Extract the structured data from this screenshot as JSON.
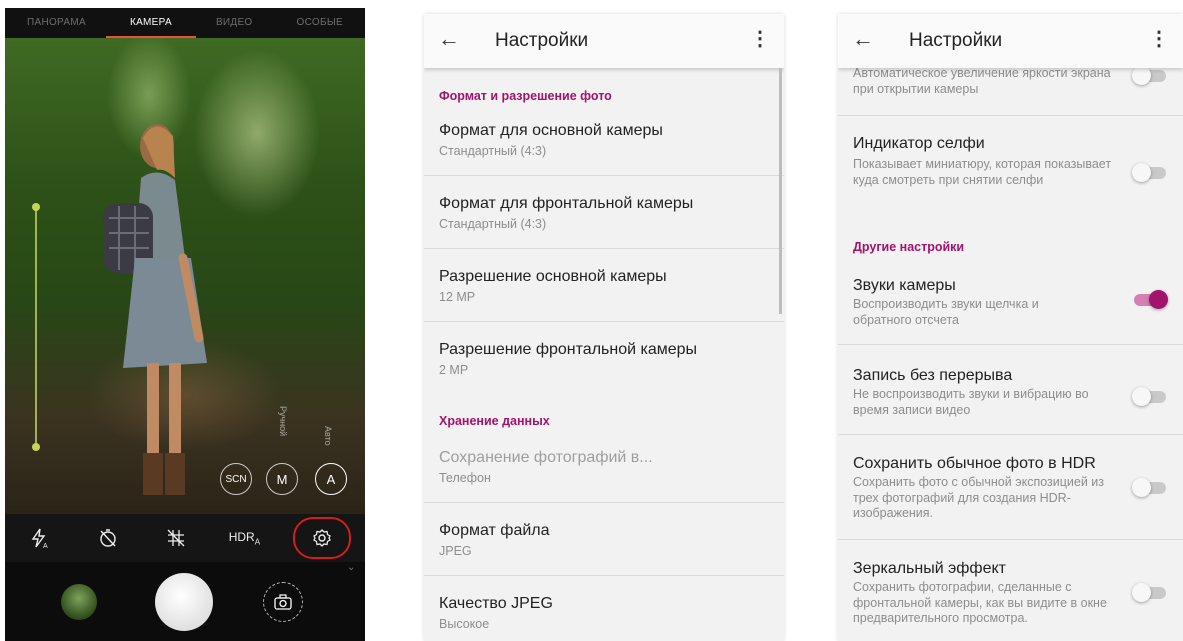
{
  "camera": {
    "tabs": [
      "ПАНОРАМА",
      "КАМЕРА",
      "ВИДЕО",
      "ОСОБЫЕ"
    ],
    "active_tab": "КАМЕРА",
    "modes": [
      "SCN",
      "M",
      "A"
    ],
    "vertical_labels": [
      "Ручной",
      "Авто"
    ],
    "toolbar": {
      "flash_icon": "flash-auto-icon",
      "timer_icon": "timer-off-icon",
      "grid_icon": "grid-off-icon",
      "hdr_label": "HDR",
      "hdr_sub": "A",
      "settings_icon": "gear-icon"
    }
  },
  "settings1": {
    "header": {
      "title": "Настройки"
    },
    "section1": "Формат и разрешение фото",
    "items1": [
      {
        "title": "Формат для основной камеры",
        "subtitle": "Стандартный (4:3)"
      },
      {
        "title": "Формат для фронтальной камеры",
        "subtitle": "Стандартный (4:3)"
      },
      {
        "title": "Разрешение основной камеры",
        "subtitle": "12 MP"
      },
      {
        "title": "Разрешение фронтальной камеры",
        "subtitle": "2 MP"
      }
    ],
    "section2": "Хранение данных",
    "items2": [
      {
        "title": "Сохранение фотографий в...",
        "subtitle": "Телефон"
      },
      {
        "title": "Формат файла",
        "subtitle": "JPEG"
      },
      {
        "title": "Качество JPEG",
        "subtitle": "Высокое"
      }
    ]
  },
  "settings2": {
    "header": {
      "title": "Настройки"
    },
    "partial_item": {
      "subtitle": "Автоматическое увеличение яркости экрана при открытии камеры",
      "on": false
    },
    "selfie": {
      "title": "Индикатор селфи",
      "subtitle": "Показывает миниатюру, которая показывает куда смотреть при снятии селфи",
      "on": false
    },
    "section": "Другие настройки",
    "items": [
      {
        "title": "Звуки камеры",
        "subtitle": "Воспроизводить звуки щелчка и обратного отсчета",
        "on": true
      },
      {
        "title": "Запись без перерыва",
        "subtitle": "Не воспроизводить звуки и вибрацию во время записи видео",
        "on": false
      },
      {
        "title": "Сохранить обычное фото в HDR",
        "subtitle": "Сохранить фото с обычной экспозицией из трех фотографий для создания HDR-изображения.",
        "on": false
      },
      {
        "title": "Зеркальный эффект",
        "subtitle": "Сохранить фотографии, сделанные с фронтальной камеры, как вы видите в окне предварительного просмотра.",
        "on": false
      }
    ]
  },
  "colors": {
    "accent": "#a1136c",
    "camera_tab_indicator": "#e8543a",
    "highlight_circle": "#d21e1e"
  }
}
